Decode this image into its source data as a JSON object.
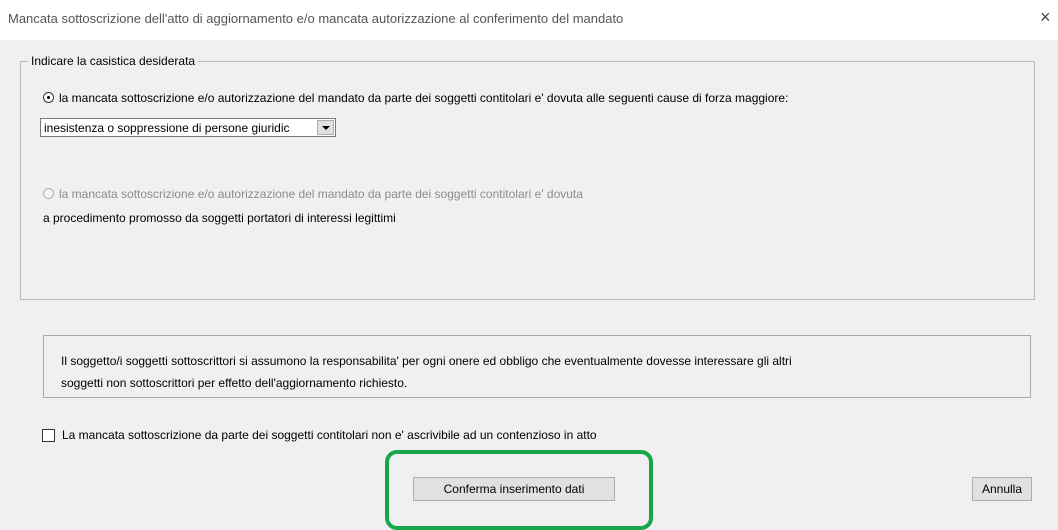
{
  "window": {
    "title": "Mancata sottoscrizione dell'atto di aggiornamento e/o mancata autorizzazione al conferimento del mandato",
    "close_glyph": "×"
  },
  "group": {
    "legend": "Indicare la casistica desiderata",
    "option1": {
      "label": "la mancata sottoscrizione e/o autorizzazione del mandato da parte dei soggetti contitolari e' dovuta alle seguenti cause di forza maggiore:",
      "selected": true
    },
    "combo": {
      "value": "inesistenza o soppressione di persone giuridic"
    },
    "option2": {
      "label": "la mancata sottoscrizione e/o autorizzazione del mandato da parte dei soggetti contitolari e' dovuta",
      "selected": false,
      "disabled": true
    },
    "option2_continuation": "a procedimento promosso da soggetti portatori di interessi legittimi"
  },
  "info": {
    "line1": "Il soggetto/i soggetti sottoscrittori si assumono la responsabilita' per ogni onere ed obbligo che eventualmente dovesse interessare gli altri",
    "line2": "soggetti non sottoscrittori per effetto dell'aggiornamento richiesto."
  },
  "checkbox": {
    "label": "La mancata sottoscrizione da parte dei soggetti contitolari non e' ascrivibile ad un contenzioso in atto",
    "checked": false
  },
  "buttons": {
    "confirm": "Conferma inserimento dati",
    "cancel": "Annulla"
  },
  "colors": {
    "highlight": "#17a649",
    "dialog_bg": "#f0f0f0"
  }
}
